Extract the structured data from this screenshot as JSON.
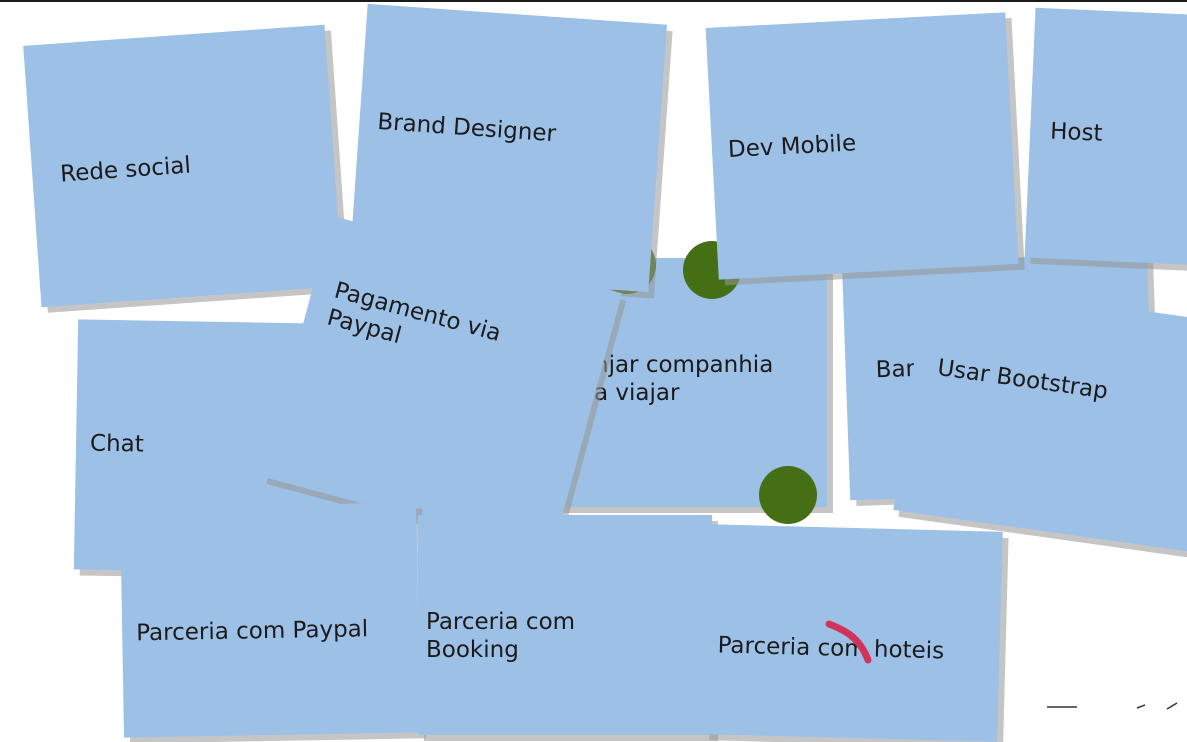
{
  "board": {
    "cards": {
      "rede_social": "Rede social",
      "brand_designer": "Brand Designer",
      "dev_mobile": "Dev Mobile",
      "host": "Host",
      "pagamento_paypal": "Pagamento via\nPaypal",
      "arranjar_companhia": "njar companhia\na viajar",
      "banner": "Ban",
      "usar_bootstrap": "Usar Bootstrap",
      "chat": "Chat",
      "parceria_paypal": "Parceria com Paypal",
      "parceria_booking": "Parceria com\nBooking",
      "parceria_hoteis": "Parceria com hoteis"
    }
  },
  "colors": {
    "card": "#9dc0e6",
    "dot": "#456f14",
    "stroke": "#d1335b"
  }
}
